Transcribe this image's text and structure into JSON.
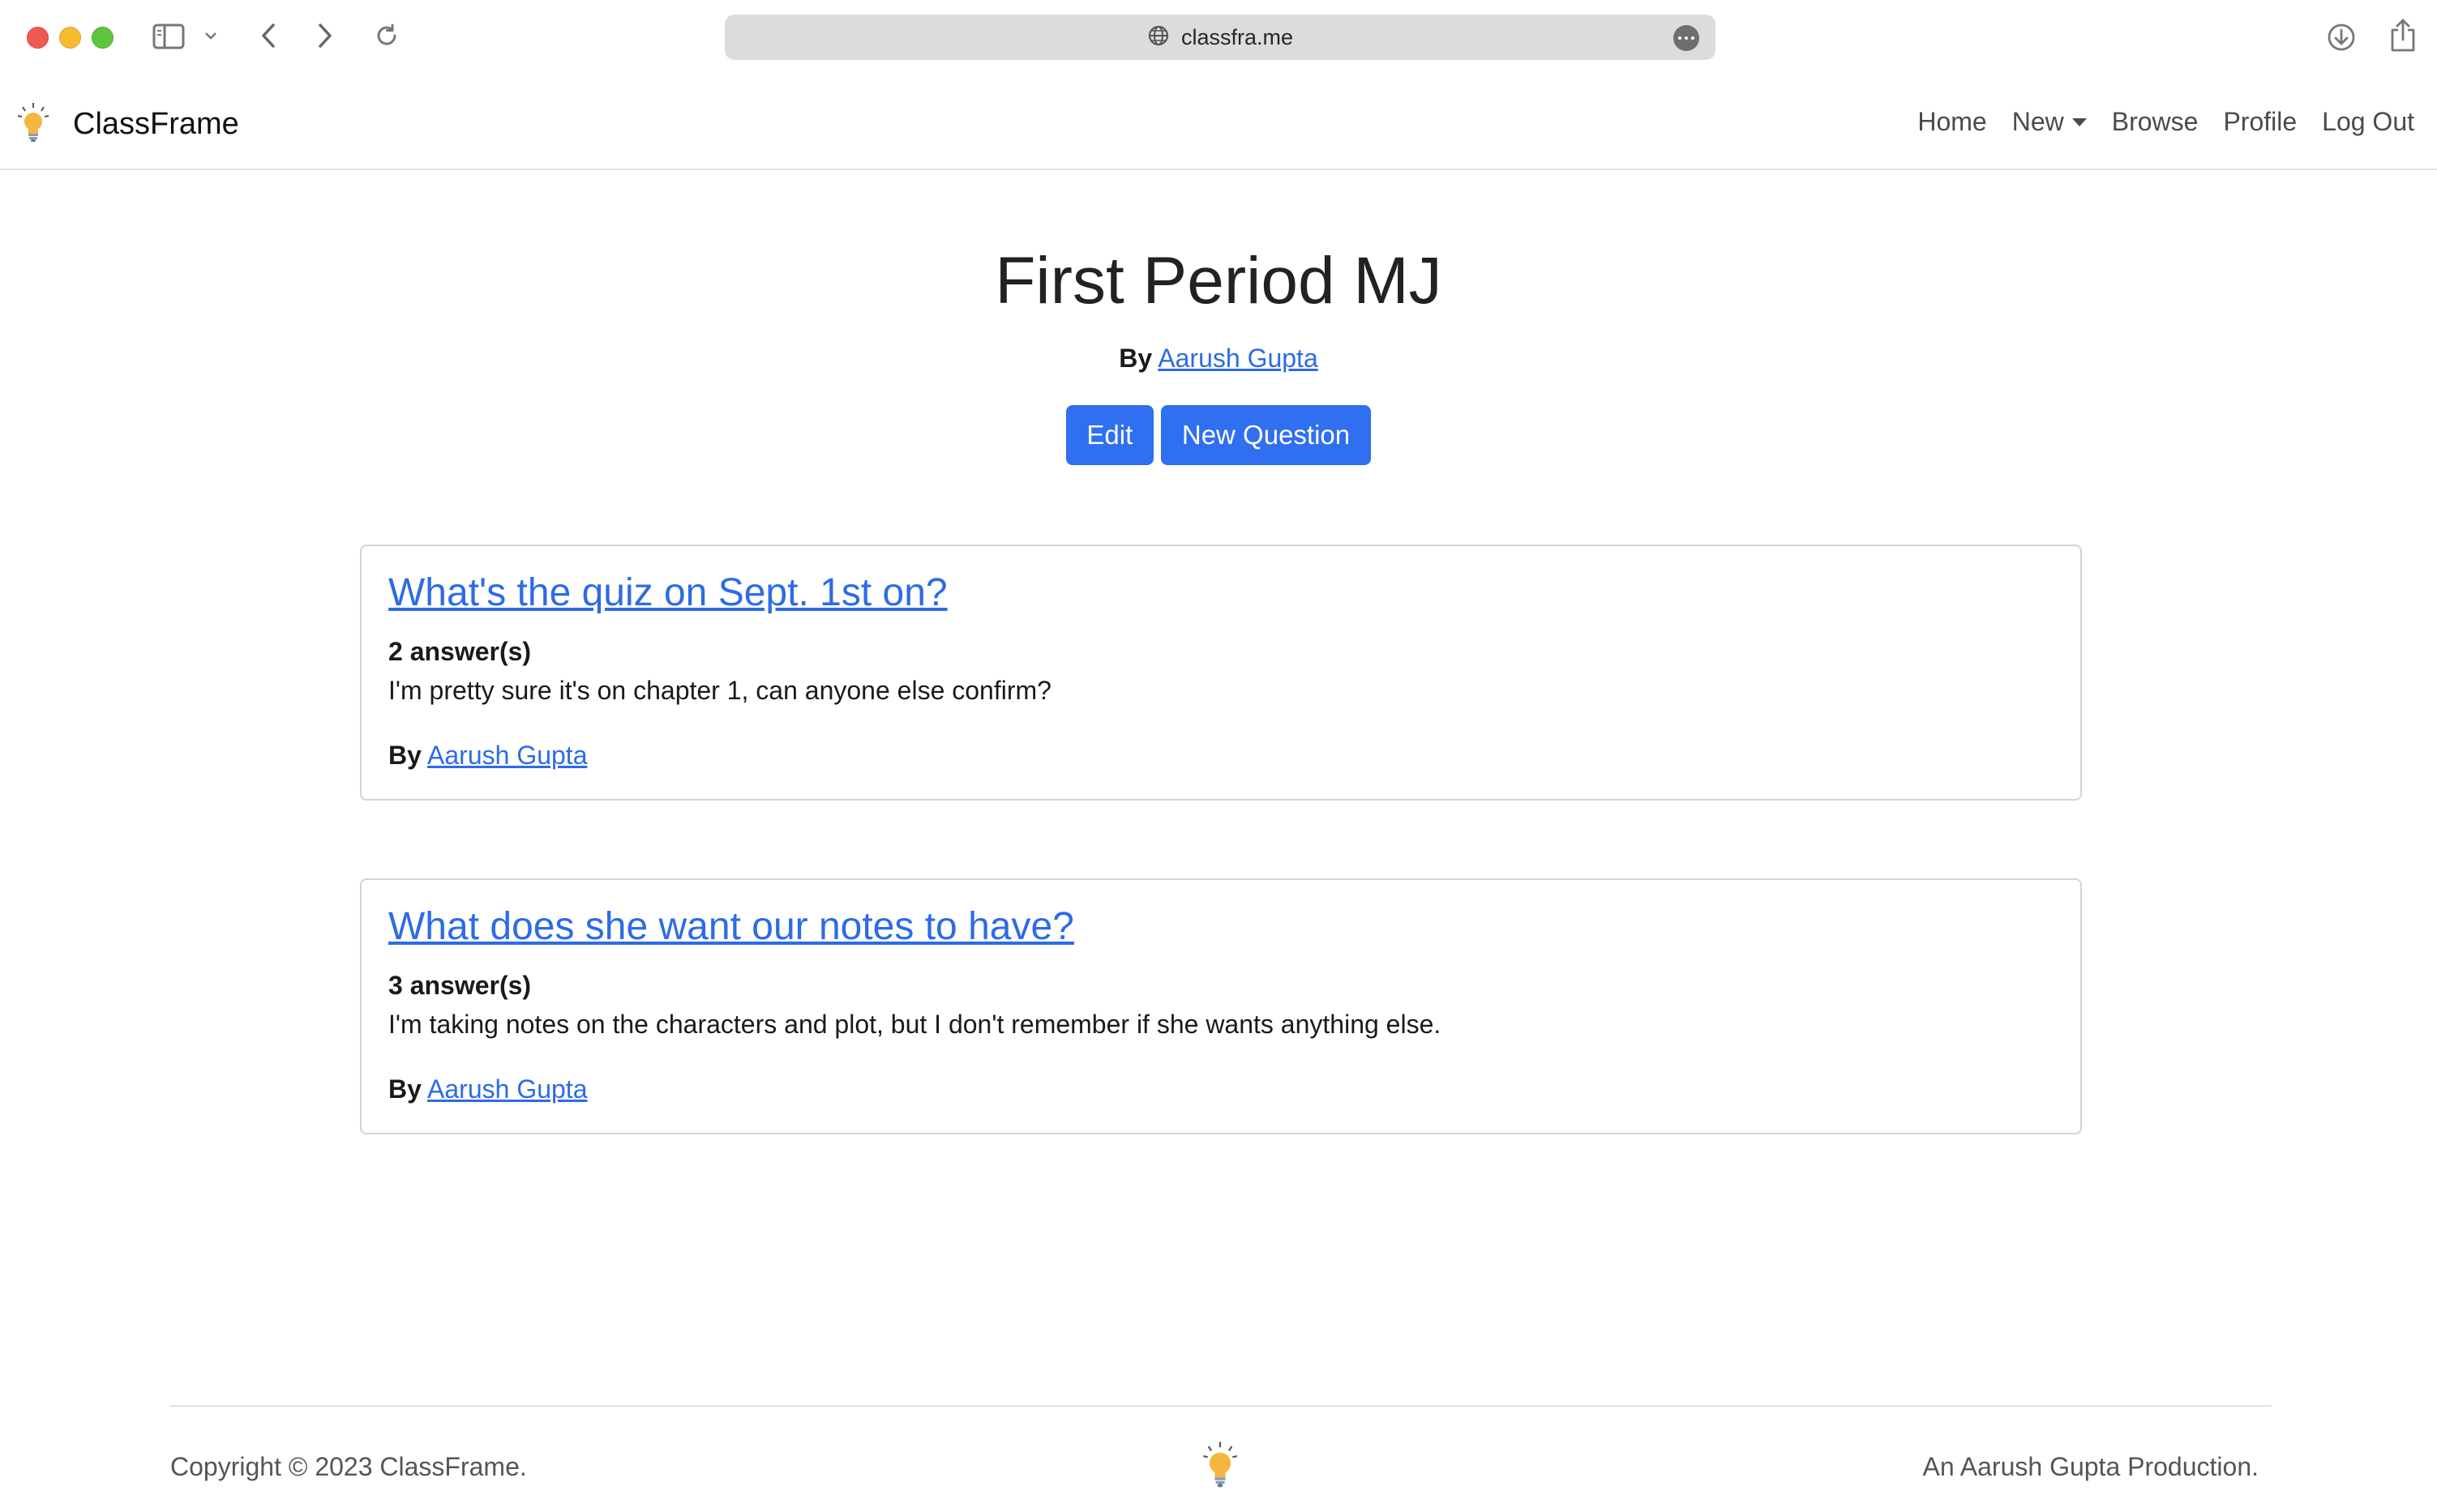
{
  "browser": {
    "url": "classfra.me"
  },
  "navbar": {
    "brand": "ClassFrame",
    "links": [
      {
        "label": "Home"
      },
      {
        "label": "New"
      },
      {
        "label": "Browse"
      },
      {
        "label": "Profile"
      },
      {
        "label": "Log Out"
      }
    ]
  },
  "page": {
    "title": "First Period MJ",
    "by_label": "By",
    "author": "Aarush Gupta",
    "buttons": {
      "edit": "Edit",
      "new_question": "New Question"
    }
  },
  "questions": [
    {
      "title": "What's the quiz on Sept. 1st on?",
      "answers": "2 answer(s)",
      "body": "I'm pretty sure it's on chapter 1, can anyone else confirm?",
      "by_label": "By",
      "author": "Aarush Gupta"
    },
    {
      "title": "What does she want our notes to have?",
      "answers": "3 answer(s)",
      "body": "I'm taking notes on the characters and plot, but I don't remember if she wants anything else.",
      "by_label": "By",
      "author": "Aarush Gupta"
    }
  ],
  "footer": {
    "copyright": "Copyright © 2023 ClassFrame.",
    "tagline": "An Aarush Gupta Production."
  },
  "colors": {
    "link": "#2d6be6",
    "button": "#2f6ff0",
    "bulb": "#f4b63f"
  }
}
